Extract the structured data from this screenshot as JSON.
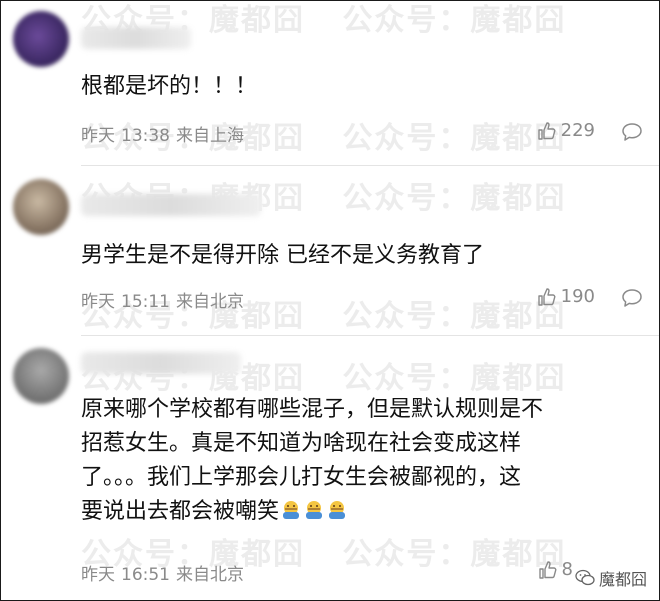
{
  "watermark": "公众号：魔都囧",
  "brand": {
    "label": "魔都囧"
  },
  "comments": [
    {
      "text": "根都是坏的！！！",
      "date": "昨天",
      "time": "13:38",
      "location": "来自上海",
      "likes": "229"
    },
    {
      "text": "男学生是不是得开除 已经不是义务教育了",
      "date": "昨天",
      "time": "15:11",
      "location": "来自北京",
      "likes": "190"
    },
    {
      "lines": [
        "原来哪个学校都有哪些混子，但是默认规则是不",
        "招惹女生。真是不知道为啥现在社会变成这样",
        "了。。。我们上学那会儿打女生会被鄙视的，这",
        "要说出去都会被嘲笑"
      ],
      "emoji": "facepalm-emoji",
      "date": "昨天",
      "time": "16:51",
      "location": "来自北京",
      "likes": "8"
    }
  ],
  "colors": {
    "meta": "#8a8a8a",
    "text": "#111111",
    "divider": "#e4e4e4"
  }
}
